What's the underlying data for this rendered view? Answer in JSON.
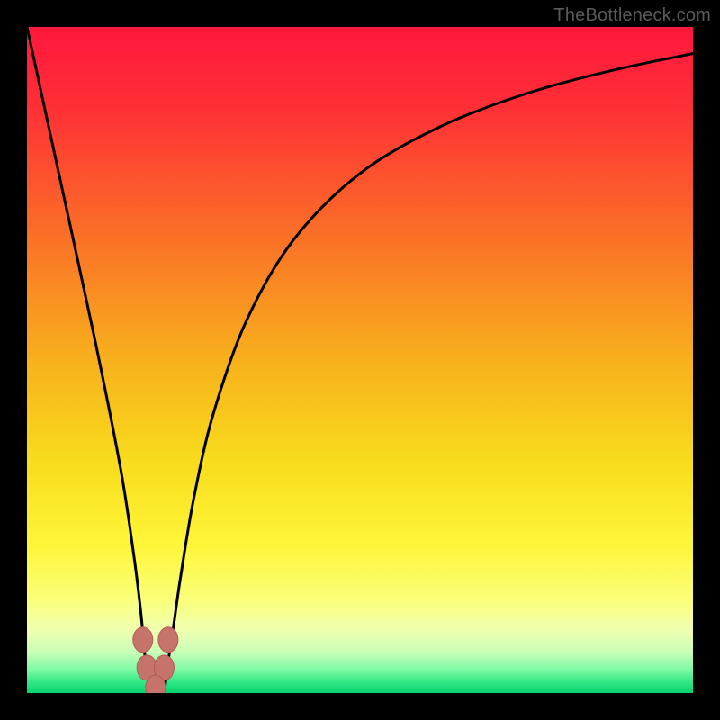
{
  "watermark": "TheBottleneck.com",
  "colors": {
    "black": "#000000",
    "curve": "#000000",
    "marker_fill": "#c6736c",
    "marker_stroke": "#b35c55",
    "gradient_stops": [
      {
        "offset": 0.0,
        "color": "#ff173d"
      },
      {
        "offset": 0.12,
        "color": "#ff2f36"
      },
      {
        "offset": 0.3,
        "color": "#fb6b28"
      },
      {
        "offset": 0.5,
        "color": "#f8b01c"
      },
      {
        "offset": 0.66,
        "color": "#f8de1d"
      },
      {
        "offset": 0.78,
        "color": "#fef63a"
      },
      {
        "offset": 0.86,
        "color": "#fbff7a"
      },
      {
        "offset": 0.905,
        "color": "#f0ffb0"
      },
      {
        "offset": 0.94,
        "color": "#c7ffb8"
      },
      {
        "offset": 0.965,
        "color": "#7cf9a4"
      },
      {
        "offset": 0.985,
        "color": "#2de583"
      },
      {
        "offset": 1.0,
        "color": "#06d36c"
      }
    ]
  },
  "chart_data": {
    "type": "line",
    "title": "",
    "xlabel": "",
    "ylabel": "",
    "xlim": [
      0,
      100
    ],
    "ylim": [
      0,
      100
    ],
    "series": [
      {
        "name": "bottleneck-curve",
        "x": [
          0,
          5,
          10,
          14,
          16,
          17,
          17.5,
          18,
          19.3,
          20.6,
          21,
          22,
          23,
          25,
          28,
          33,
          40,
          50,
          62,
          75,
          88,
          100
        ],
        "values": [
          100,
          77,
          54,
          34,
          21,
          13,
          8,
          3.5,
          0.5,
          0.5,
          3.5,
          10,
          17,
          29,
          42,
          56,
          68,
          78,
          85,
          90,
          93.5,
          96
        ]
      }
    ],
    "markers": [
      {
        "name": "left-top-marker",
        "x": 17.4,
        "y": 8.0
      },
      {
        "name": "right-top-marker",
        "x": 21.2,
        "y": 8.0
      },
      {
        "name": "left-mid-marker",
        "x": 18.0,
        "y": 3.8
      },
      {
        "name": "right-mid-marker",
        "x": 20.6,
        "y": 3.8
      },
      {
        "name": "bottom-marker",
        "x": 19.3,
        "y": 0.8
      }
    ],
    "legend": [],
    "grid": false
  }
}
